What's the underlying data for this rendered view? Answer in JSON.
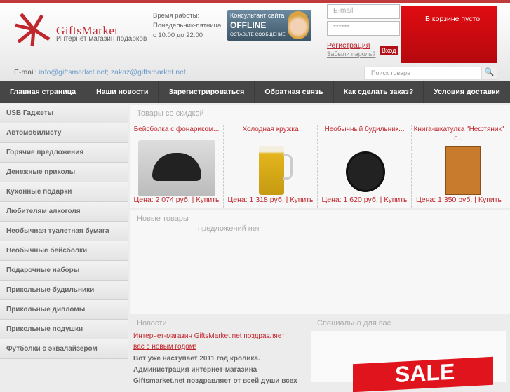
{
  "header": {
    "brand": "GiftsMarket",
    "tagline": "Интернет магазин подарков",
    "hours": [
      "Время работы:",
      "Понедельник-пятница",
      "с 10:00 до 22:00"
    ],
    "consultant": {
      "line1": "Консультант сайта",
      "status": "OFFLINE",
      "action": "ОСТАВЬТЕ СООБЩЕНИЕ"
    },
    "email_placeholder": "E-mail",
    "password_placeholder": "******",
    "register": "Регистрация",
    "forgot": "Забыли пароль?",
    "login": "Вход",
    "cart": "В корзине пусто",
    "email_label": "E-mail:",
    "emails": "info@giftsmarket.net; zakaz@giftsmarket.net",
    "search_placeholder": "Поиск товара"
  },
  "nav": [
    "Главная страница",
    "Наши новости",
    "Зарегистрироваться",
    "Обратная связь",
    "Как сделать заказ?",
    "Условия доставки"
  ],
  "sidebar": [
    "USB Гаджеты",
    "Автомобилисту",
    "Горячие предложения",
    "Денежные приколы",
    "Кухонные подарки",
    "Любителям алкоголя",
    "Необычная туалетная бумага",
    "Необычные бейсболки",
    "Подарочные наборы",
    "Прикольные будильники",
    "Прикольные дипломы",
    "Прикольные подушки",
    "Футболки с эквалайзером"
  ],
  "discount": {
    "title": "Товары со скидкой",
    "products": [
      {
        "name": "Бейсболка с фонариком...",
        "price": "Цена: 2 074 руб. | Купить"
      },
      {
        "name": "Холодная кружка",
        "price": "Цена: 1 318 руб. | Купить"
      },
      {
        "name": "Необычный будильник...",
        "price": "Цена: 1 620 руб. | Купить"
      },
      {
        "name": "Книга-шкатулка \"Нефтяник\" с...",
        "price": "Цена: 1 350 руб. | Купить"
      }
    ]
  },
  "new": {
    "title": "Новые товары",
    "empty": "предложений нет"
  },
  "news": {
    "title": "Новости",
    "headline": "Интернет-магазин GiftsMarket.net поздравляет вас с новым годом!",
    "text": "Вот уже наступает 2011 год кролика. Администрация интернет-магазина Giftsmarket.net поздравляет от всей души всех"
  },
  "special": {
    "title": "Специально для вас",
    "banner": "SALE"
  }
}
